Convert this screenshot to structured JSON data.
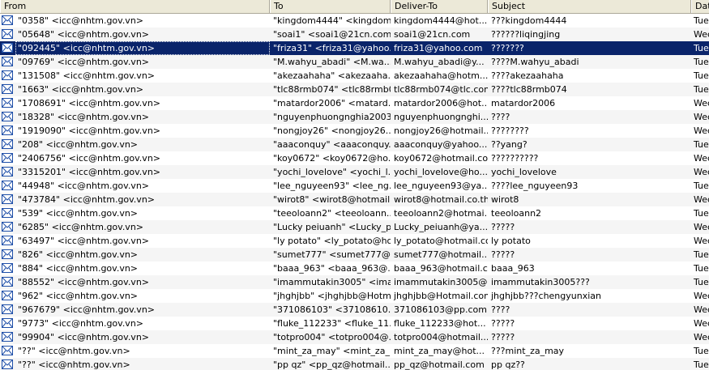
{
  "columns": {
    "from": "From",
    "to": "To",
    "deliver_to": "Deliver-To",
    "subject": "Subject",
    "date": "Date"
  },
  "icon": "envelope-icon",
  "colors": {
    "selection": "#0a246a",
    "header": "#ece9d8",
    "alt_row": "#f5f5f5"
  },
  "selected_index": 2,
  "rows": [
    {
      "from": "\"0358\" <icc@nhtm.gov.vn>",
      "to": "\"kingdom4444\" <kingdom...",
      "deliver_to": "kingdom4444@hot...",
      "subject": "???kingdom4444",
      "date": "Tue"
    },
    {
      "from": "\"05648\" <icc@nhtm.gov.vn>",
      "to": "\"soai1\" <soai1@21cn.com>",
      "deliver_to": "soai1@21cn.com",
      "subject": "??????liqingjing",
      "date": "Wec"
    },
    {
      "from": "\"092445\" <icc@nhtm.gov.vn>",
      "to": "\"friza31\" <friza31@yahoo...",
      "deliver_to": "friza31@yahoo.com",
      "subject": "???????",
      "date": "Tue"
    },
    {
      "from": "\"09769\" <icc@nhtm.gov.vn>",
      "to": "\"M.wahyu_abadi\" <M.wa...",
      "deliver_to": "M.wahyu_abadi@y...",
      "subject": "????M.wahyu_abadi",
      "date": "Tue"
    },
    {
      "from": "\"131508\" <icc@nhtm.gov.vn>",
      "to": "\"akezaahaha\" <akezaaha...",
      "deliver_to": "akezaahaha@hotm...",
      "subject": "????akezaahaha",
      "date": "Tue"
    },
    {
      "from": "\"1663\" <icc@nhtm.gov.vn>",
      "to": "\"tlc88rmb074\" <tlc88rmb0...",
      "deliver_to": "tlc88rmb074@tlc.com",
      "subject": "????tlc88rmb074",
      "date": "Tue"
    },
    {
      "from": "\"1708691\" <icc@nhtm.gov.vn>",
      "to": "\"matardor2006\" <matard...",
      "deliver_to": "matardor2006@hot...",
      "subject": "matardor2006",
      "date": "Wec"
    },
    {
      "from": "\"18328\" <icc@nhtm.gov.vn>",
      "to": "\"nguyenphuongnghia2003...",
      "deliver_to": "nguyenphuongnghi...",
      "subject": "????",
      "date": "Wec"
    },
    {
      "from": "\"1919090\" <icc@nhtm.gov.vn>",
      "to": "\"nongjoy26\" <nongjoy26...",
      "deliver_to": "nongjoy26@hotmail...",
      "subject": "????????",
      "date": "Wec"
    },
    {
      "from": "\"208\" <icc@nhtm.gov.vn>",
      "to": "\"aaaconquy\" <aaaconquy...",
      "deliver_to": "aaaconquy@yahoo....",
      "subject": "??yang?",
      "date": "Tue"
    },
    {
      "from": "\"2406756\" <icc@nhtm.gov.vn>",
      "to": "\"koy0672\" <koy0672@ho...",
      "deliver_to": "koy0672@hotmail.com",
      "subject": "??????????",
      "date": "Wec"
    },
    {
      "from": "\"3315201\" <icc@nhtm.gov.vn>",
      "to": "\"yochi_lovelove\" <yochi_l...",
      "deliver_to": "yochi_lovelove@ho...",
      "subject": "yochi_lovelove",
      "date": "Wec"
    },
    {
      "from": "\"44948\" <icc@nhtm.gov.vn>",
      "to": "\"lee_nguyeen93\" <lee_ng...",
      "deliver_to": "lee_nguyeen93@ya...",
      "subject": "????lee_nguyeen93",
      "date": "Tue"
    },
    {
      "from": "\"473784\" <icc@nhtm.gov.vn>",
      "to": "\"wirot8\" <wirot8@hotmail....",
      "deliver_to": "wirot8@hotmail.co.th",
      "subject": "wirot8",
      "date": "Wec"
    },
    {
      "from": "\"539\" <icc@nhtm.gov.vn>",
      "to": "\"teeoloann2\" <teeoloann...",
      "deliver_to": "teeoloann2@hotmai...",
      "subject": "teeoloann2",
      "date": "Tue"
    },
    {
      "from": "\"6285\" <icc@nhtm.gov.vn>",
      "to": "\"Lucky peiuanh\" <Lucky_p...",
      "deliver_to": "Lucky_peiuanh@ya...",
      "subject": "?????",
      "date": "Wec"
    },
    {
      "from": "\"63497\" <icc@nhtm.gov.vn>",
      "to": "\"ly potato\" <ly_potato@ho...",
      "deliver_to": "ly_potato@hotmail.com",
      "subject": "ly potato",
      "date": "Wec"
    },
    {
      "from": "\"826\" <icc@nhtm.gov.vn>",
      "to": "\"sumet777\" <sumet777@h...",
      "deliver_to": "sumet777@hotmail....",
      "subject": "?????",
      "date": "Tue"
    },
    {
      "from": "\"884\" <icc@nhtm.gov.vn>",
      "to": "\"baaa_963\" <baaa_963@...",
      "deliver_to": "baaa_963@hotmail.com",
      "subject": "baaa_963",
      "date": "Tue"
    },
    {
      "from": "\"88552\" <icc@nhtm.gov.vn>",
      "to": "\"imammutakin3005\" <ima...",
      "deliver_to": "imammutakin3005@...",
      "subject": "imammutakin3005???",
      "date": "Tue"
    },
    {
      "from": "\"962\" <icc@nhtm.gov.vn>",
      "to": "\"jhghjbb\" <jhghjbb@Hotm...",
      "deliver_to": "jhghjbb@Hotmail.com",
      "subject": "jhghjbb???chengyunxian",
      "date": "Wec"
    },
    {
      "from": "\"967679\" <icc@nhtm.gov.vn>",
      "to": "\"371086103\" <37108610...",
      "deliver_to": "371086103@pp.com",
      "subject": "????",
      "date": "Wec"
    },
    {
      "from": "\"9773\" <icc@nhtm.gov.vn>",
      "to": "\"fluke_112233\" <fluke_11...",
      "deliver_to": "fluke_112233@hot...",
      "subject": "?????",
      "date": "Wec"
    },
    {
      "from": "\"99904\" <icc@nhtm.gov.vn>",
      "to": "\"totpro004\" <totpro004@...",
      "deliver_to": "totpro004@hotmail....",
      "subject": "?????",
      "date": "Wec"
    },
    {
      "from": "\"??\" <icc@nhtm.gov.vn>",
      "to": "\"mint_za_may\" <mint_za_...",
      "deliver_to": "mint_za_may@hot...",
      "subject": "???mint_za_may",
      "date": "Tue"
    },
    {
      "from": "\"??\" <icc@nhtm.gov.vn>",
      "to": "\"pp qz\" <pp_qz@hotmail....",
      "deliver_to": "pp_qz@hotmail.com",
      "subject": "pp qz??",
      "date": "Tue"
    }
  ]
}
